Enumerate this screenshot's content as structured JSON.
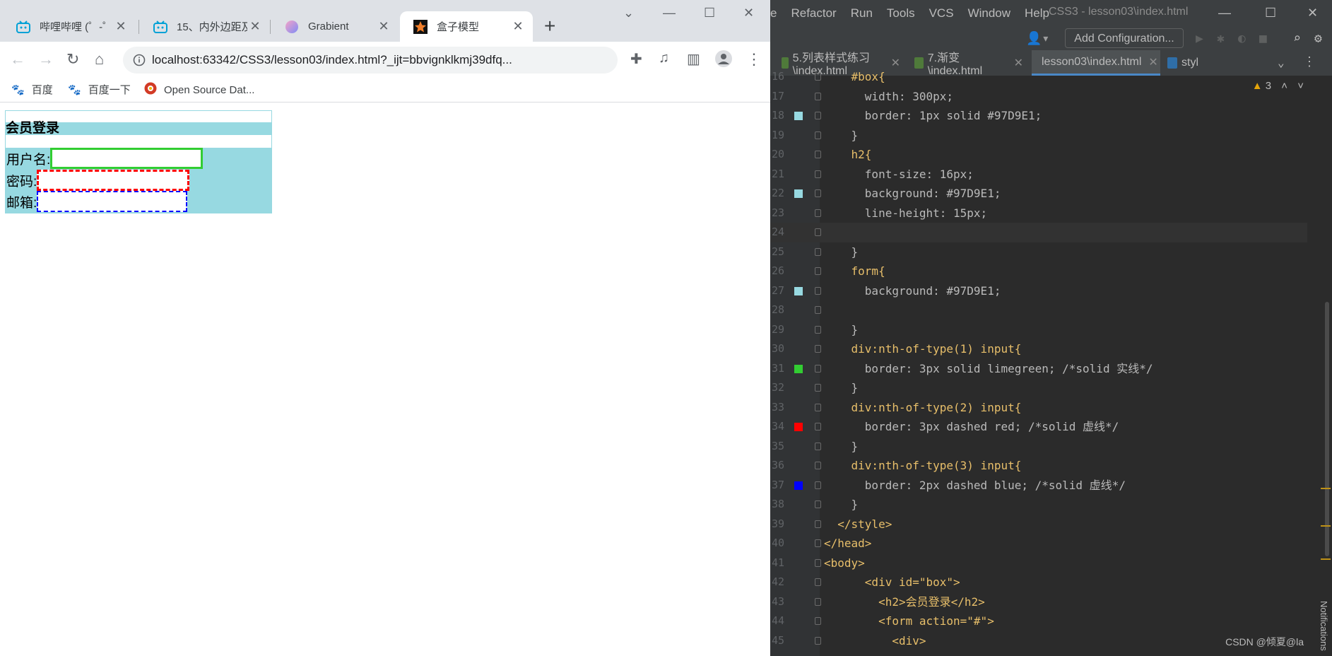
{
  "browser": {
    "tabs": [
      {
        "title": "哔哩哔哩 (゜-゜",
        "favicon": "bilibili-icon"
      },
      {
        "title": "15、内外边距及",
        "favicon": "bilibili-icon"
      },
      {
        "title": "Grabient",
        "favicon": "grabient-icon"
      },
      {
        "title": "盒子模型",
        "favicon": "webstorm-icon",
        "active": true
      }
    ],
    "url": "localhost:63342/CSS3/lesson03/index.html?_ijt=bbvignklkmj39dfq...",
    "bookmarks": [
      {
        "label": "百度",
        "icon": "baidu-icon"
      },
      {
        "label": "百度一下",
        "icon": "baidu-icon"
      },
      {
        "label": "Open Source Dat...",
        "icon": "opensource-icon"
      }
    ]
  },
  "page": {
    "heading": "会员登录",
    "fields": [
      {
        "label": "用户名:",
        "value": ""
      },
      {
        "label": "密码:",
        "value": ""
      },
      {
        "label": "邮箱:",
        "value": ""
      }
    ],
    "colors": {
      "accent": "#97D9E1",
      "field1": "limegreen",
      "field2": "red",
      "field3": "blue"
    }
  },
  "ide": {
    "menu": [
      "e",
      "Refactor",
      "Run",
      "Tools",
      "VCS",
      "Window",
      "Help"
    ],
    "window_title": "CSS3 - lesson03\\index.html",
    "add_configuration": "Add Configuration...",
    "editor_tabs": [
      {
        "label": "5.列表样式练习\\index.html",
        "type": "html"
      },
      {
        "label": "7.渐变\\index.html",
        "type": "html"
      },
      {
        "label": "lesson03\\index.html",
        "type": "html",
        "active": true
      },
      {
        "label": "styl",
        "type": "css"
      }
    ],
    "warnings_count": "3",
    "watermark": "CSDN @倾夏@la",
    "notifications": "Notifications",
    "lines": [
      {
        "n": "16",
        "code": "    #box{",
        "cls": "t-sel"
      },
      {
        "n": "17",
        "code": "      width: 300px;",
        "cls": "t-prop"
      },
      {
        "n": "18",
        "code": "      border: 1px solid #97D9E1;",
        "cls": "t-prop",
        "swatch": "#97D9E1"
      },
      {
        "n": "19",
        "code": "    }",
        "cls": "t-prop"
      },
      {
        "n": "20",
        "code": "    h2{",
        "cls": "t-sel"
      },
      {
        "n": "21",
        "code": "      font-size: 16px;",
        "cls": "t-prop"
      },
      {
        "n": "22",
        "code": "      background: #97D9E1;",
        "cls": "t-prop",
        "swatch": "#97D9E1"
      },
      {
        "n": "23",
        "code": "      line-height: 15px;",
        "cls": "t-prop"
      },
      {
        "n": "24",
        "code": "",
        "cls": "t-prop",
        "current": true
      },
      {
        "n": "25",
        "code": "    }",
        "cls": "t-prop"
      },
      {
        "n": "26",
        "code": "    form{",
        "cls": "t-sel"
      },
      {
        "n": "27",
        "code": "      background: #97D9E1;",
        "cls": "t-prop",
        "swatch": "#97D9E1"
      },
      {
        "n": "28",
        "code": "",
        "cls": "t-prop"
      },
      {
        "n": "29",
        "code": "    }",
        "cls": "t-prop"
      },
      {
        "n": "30",
        "code": "    div:nth-of-type(1) input{",
        "cls": "t-sel"
      },
      {
        "n": "31",
        "code": "      border: 3px solid limegreen; /*solid 实线*/",
        "cls": "t-prop",
        "swatch": "#32cd32"
      },
      {
        "n": "32",
        "code": "    }",
        "cls": "t-prop"
      },
      {
        "n": "33",
        "code": "    div:nth-of-type(2) input{",
        "cls": "t-sel"
      },
      {
        "n": "34",
        "code": "      border: 3px dashed red; /*solid 虚线*/",
        "cls": "t-prop",
        "swatch": "#ff0000"
      },
      {
        "n": "35",
        "code": "    }",
        "cls": "t-prop"
      },
      {
        "n": "36",
        "code": "    div:nth-of-type(3) input{",
        "cls": "t-sel"
      },
      {
        "n": "37",
        "code": "      border: 2px dashed blue; /*solid 虚线*/",
        "cls": "t-prop",
        "swatch": "#0000ff"
      },
      {
        "n": "38",
        "code": "    }",
        "cls": "t-prop"
      },
      {
        "n": "39",
        "code": "  </style>",
        "cls": "t-tag"
      },
      {
        "n": "40",
        "code": "</head>",
        "cls": "t-tag"
      },
      {
        "n": "41",
        "code": "<body>",
        "cls": "t-tag"
      },
      {
        "n": "42",
        "code": "      <div id=\"box\">",
        "cls": "t-tag"
      },
      {
        "n": "43",
        "code": "        <h2>会员登录</h2>",
        "cls": "t-tag"
      },
      {
        "n": "44",
        "code": "        <form action=\"#\">",
        "cls": "t-tag"
      },
      {
        "n": "45",
        "code": "          <div>",
        "cls": "t-tag"
      }
    ]
  }
}
